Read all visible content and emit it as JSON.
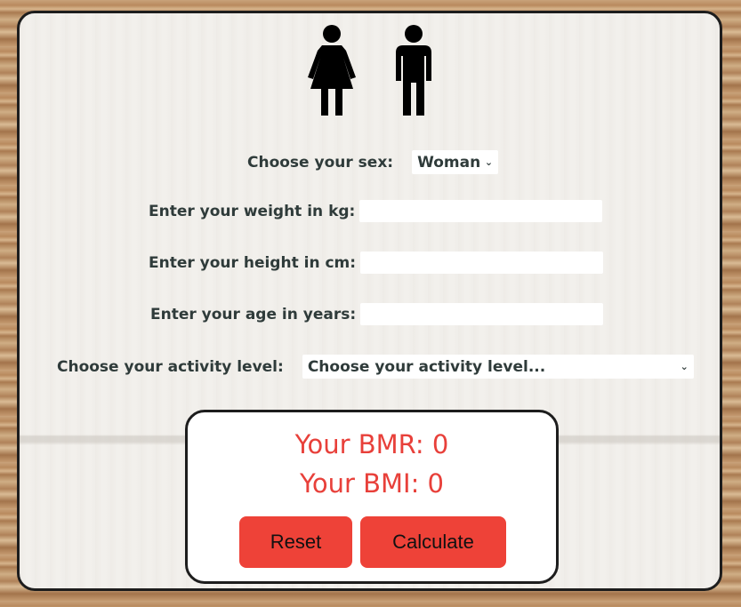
{
  "icons": {
    "woman": "woman-figure-icon",
    "man": "man-figure-icon"
  },
  "form": {
    "sex_label": "Choose your sex:",
    "sex_value": "Woman",
    "weight_label": "Enter your weight in kg:",
    "weight_value": "",
    "height_label": "Enter your height in cm:",
    "height_value": "",
    "age_label": "Enter your age in years:",
    "age_value": "",
    "activity_label": "Choose your activity level:",
    "activity_value": "Choose your activity level..."
  },
  "results": {
    "bmr": "Your BMR: 0",
    "bmi": "Your BMI: 0"
  },
  "buttons": {
    "reset": "Reset",
    "calculate": "Calculate"
  },
  "colors": {
    "accent": "#ee4238",
    "result_text": "#e8403a",
    "label_text": "#2f3b3a"
  }
}
